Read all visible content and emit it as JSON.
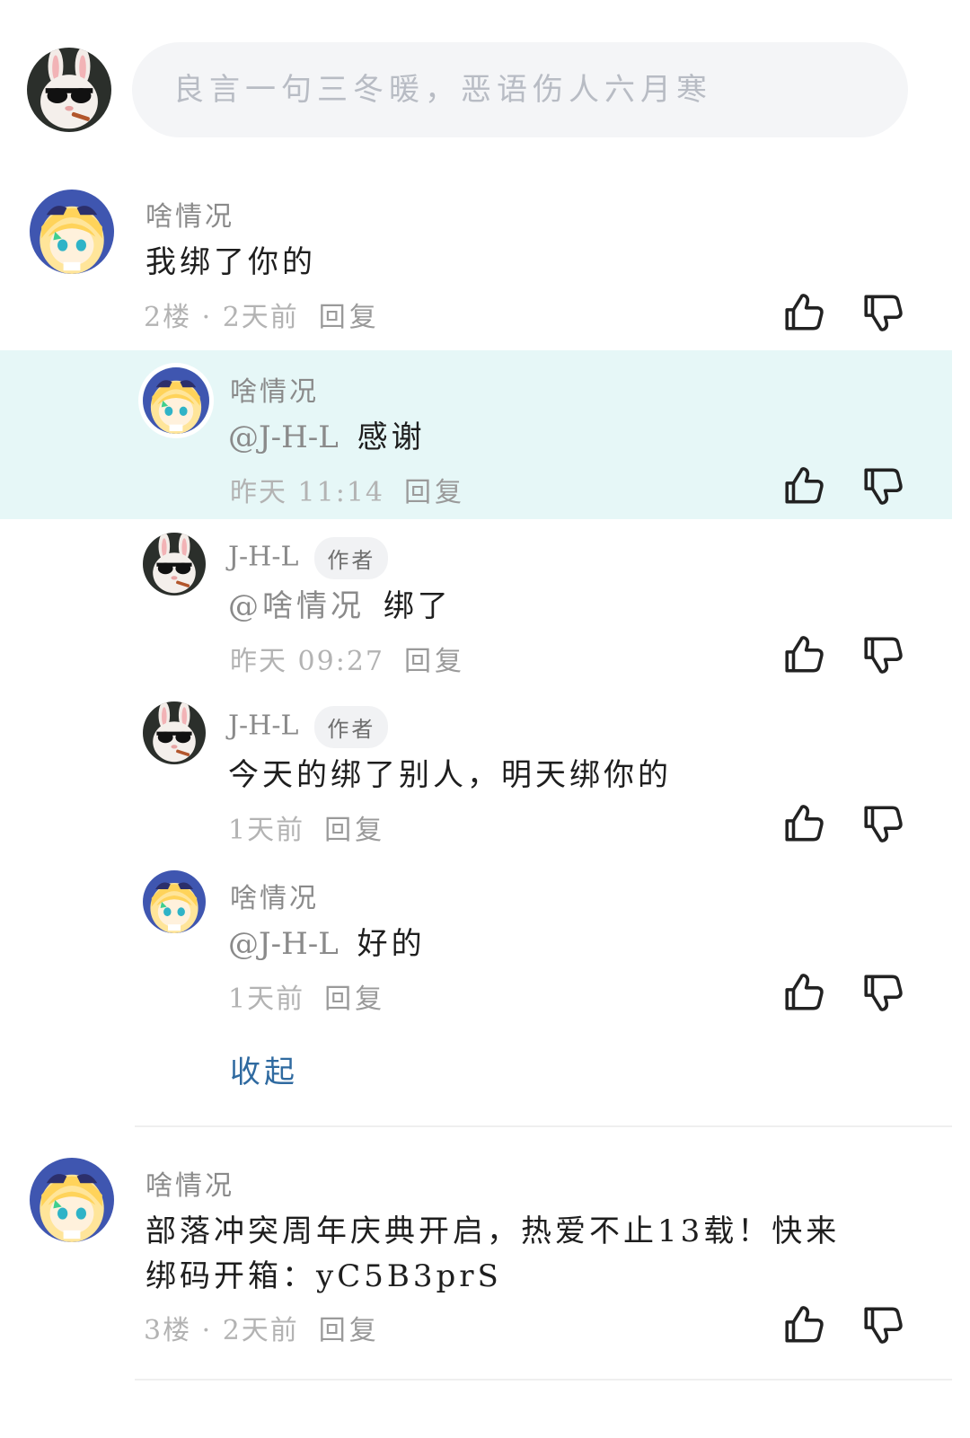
{
  "input": {
    "placeholder": "良言一句三冬暖，恶语伤人六月寒"
  },
  "comments": [
    {
      "user": "啥情况",
      "content": "我绑了你的",
      "floor": "2楼",
      "time": "2天前",
      "reply_label": "回复",
      "avatar": "anime-girl"
    },
    {
      "user": "啥情况",
      "content": "部落冲突周年庆典开启，热爱不止13载！快来绑码开箱：yC5B3prS",
      "content_line1": "部落冲突周年庆典开启，热爱不止13载！快来",
      "content_line2": "绑码开箱：yC5B3prS",
      "floor": "3楼",
      "time": "2天前",
      "reply_label": "回复",
      "avatar": "anime-girl"
    }
  ],
  "replies": [
    {
      "user": "啥情况",
      "mention": "@J-H-L",
      "text": "感谢",
      "time": "昨天 11:14",
      "reply_label": "回复",
      "highlighted": true,
      "avatar": "anime-girl"
    },
    {
      "user": "J-H-L",
      "badge": "作者",
      "mention": "@啥情况",
      "text": "绑了",
      "time": "昨天 09:27",
      "reply_label": "回复",
      "avatar": "rabbit-sunglasses"
    },
    {
      "user": "J-H-L",
      "badge": "作者",
      "text": "今天的绑了别人，明天绑你的",
      "time": "1天前",
      "reply_label": "回复",
      "avatar": "rabbit-sunglasses"
    },
    {
      "user": "啥情况",
      "mention": "@J-H-L",
      "text": "好的",
      "time": "1天前",
      "reply_label": "回复",
      "avatar": "anime-girl"
    }
  ],
  "collapse_label": "收起",
  "icons": {
    "like": "thumbs-up-icon",
    "dislike": "thumbs-down-icon"
  },
  "colors": {
    "highlight_bg": "#e6f7f7",
    "link": "#2f6aa0",
    "meta": "#b3b3b3"
  }
}
